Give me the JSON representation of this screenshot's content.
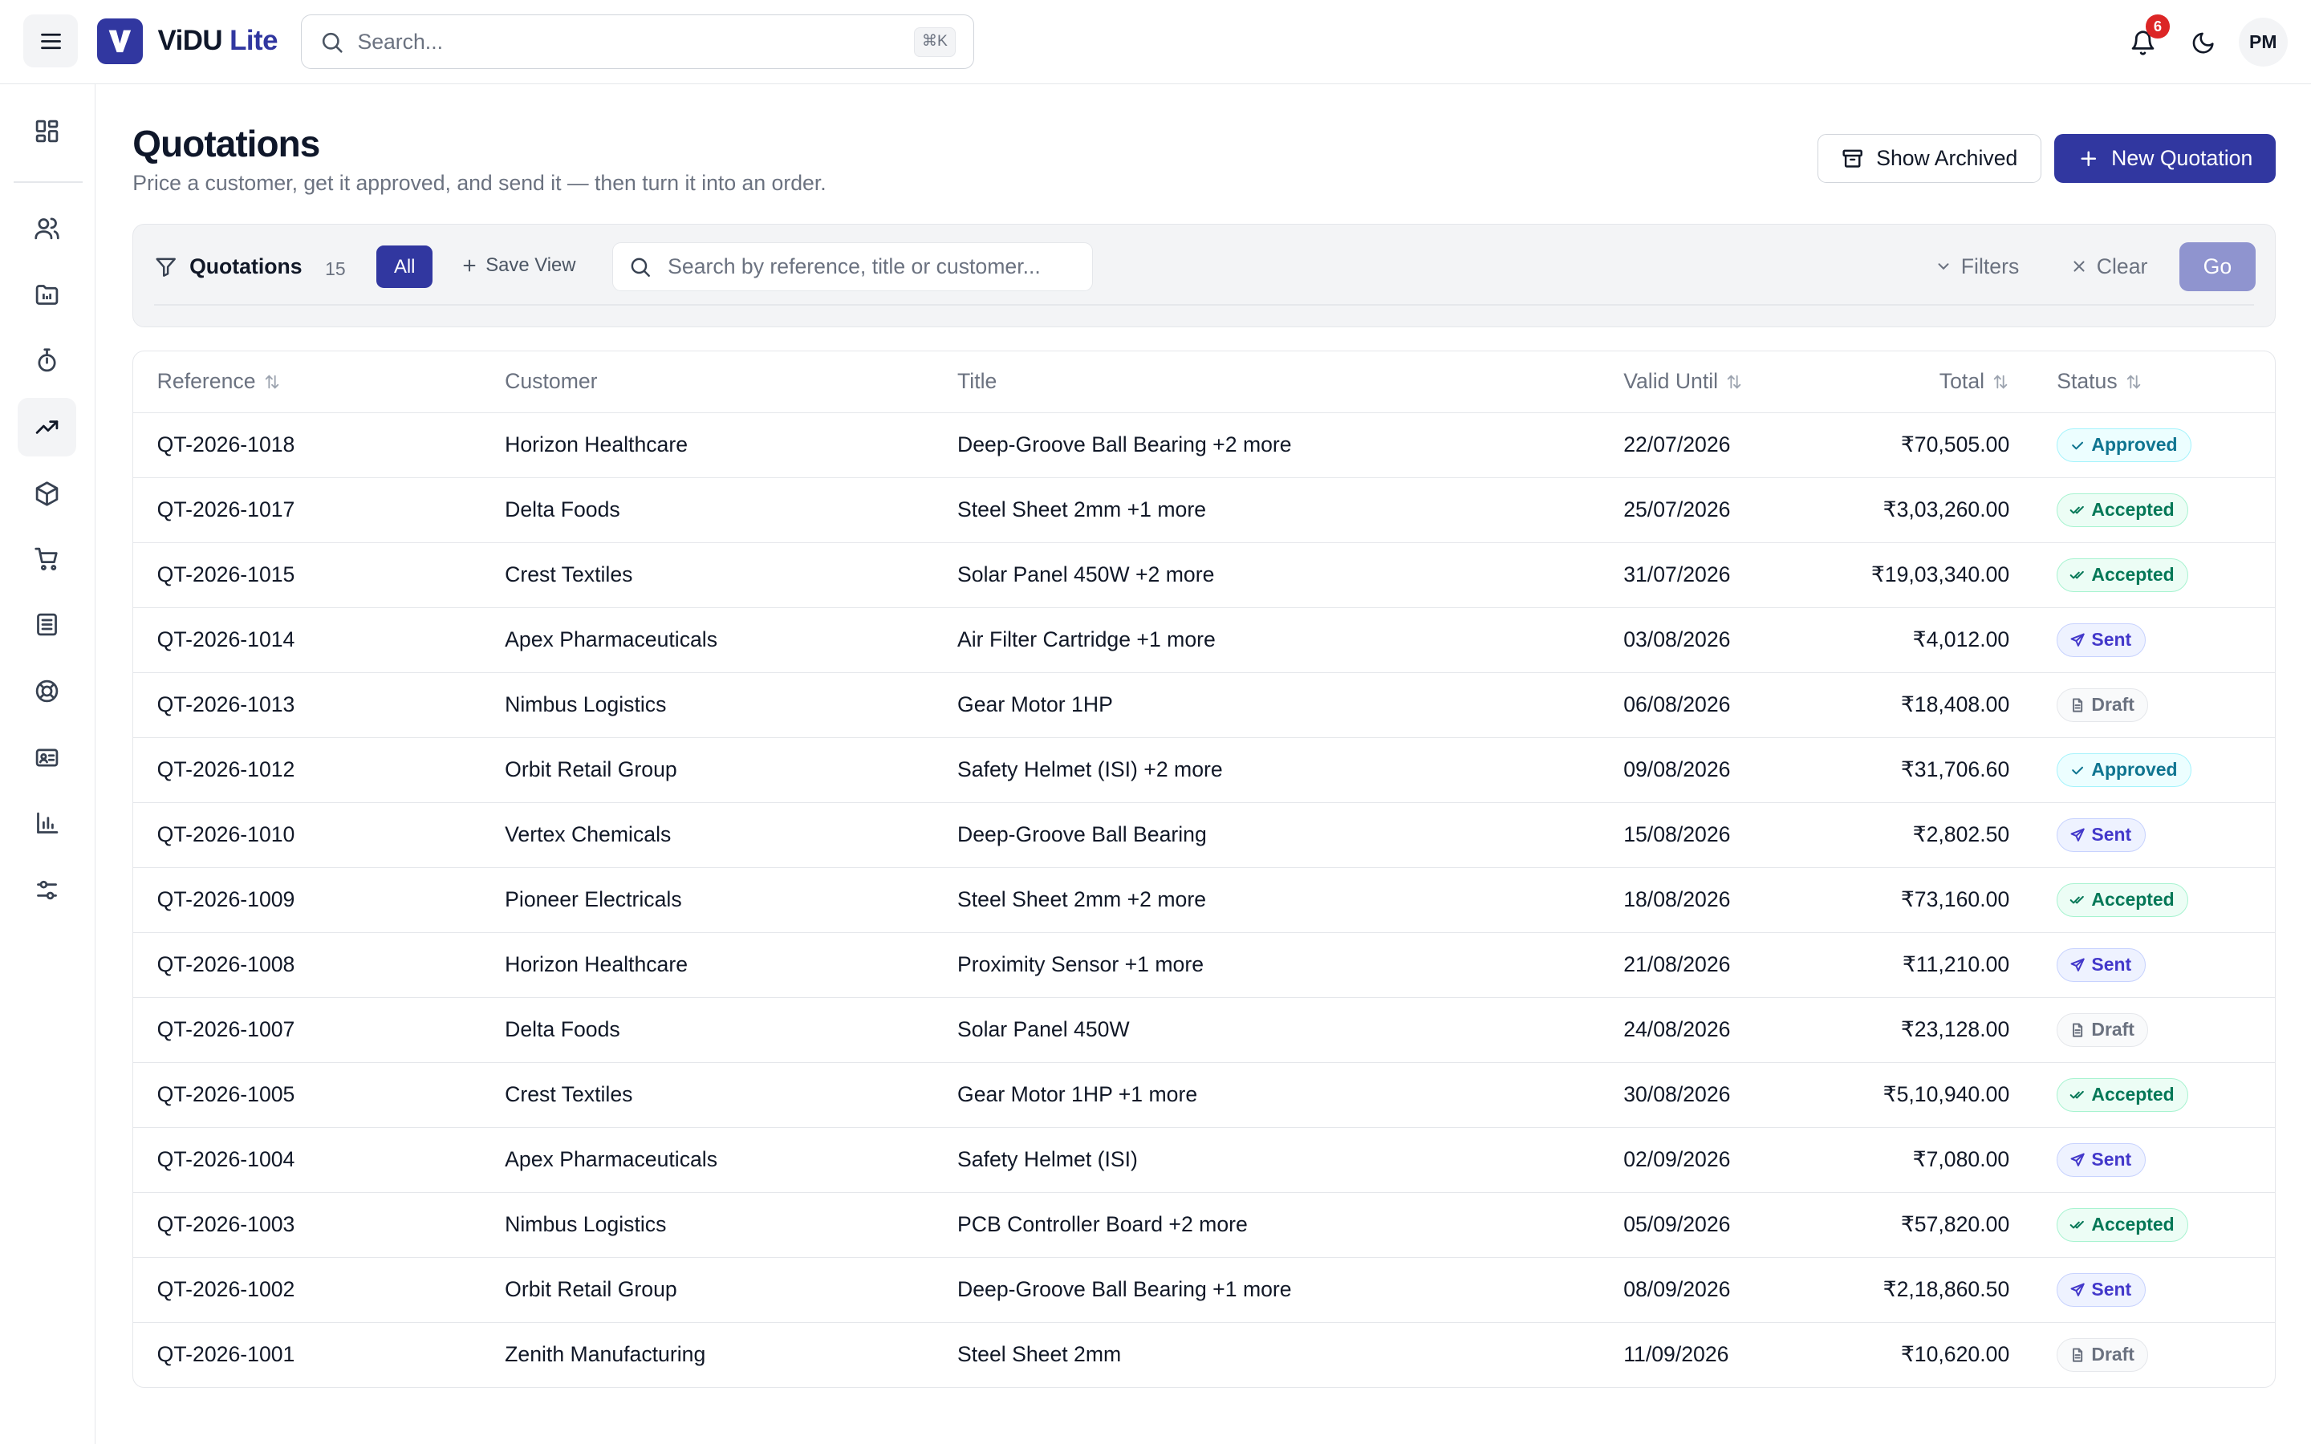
{
  "app": {
    "brand_main": "ViDU",
    "brand_sub": "Lite",
    "brand_color": "#3137a0"
  },
  "topbar": {
    "search_placeholder": "Search...",
    "search_shortcut": "⌘K",
    "notification_count": "6",
    "avatar_initials": "PM"
  },
  "sidebar": {
    "items": [
      {
        "icon": "dashboard-icon",
        "active": false
      },
      {
        "icon": "users-icon",
        "active": false
      },
      {
        "icon": "projects-folder-icon",
        "active": false
      },
      {
        "icon": "stopwatch-icon",
        "active": false
      },
      {
        "icon": "sales-trend-icon",
        "active": true
      },
      {
        "icon": "package-icon",
        "active": false
      },
      {
        "icon": "cart-icon",
        "active": false
      },
      {
        "icon": "ledger-icon",
        "active": false
      },
      {
        "icon": "support-lifebuoy-icon",
        "active": false
      },
      {
        "icon": "id-card-icon",
        "active": false
      },
      {
        "icon": "bar-chart-icon",
        "active": false
      },
      {
        "icon": "settings-sliders-icon",
        "active": false
      }
    ]
  },
  "page": {
    "title": "Quotations",
    "subtitle": "Price a customer, get it approved, and send it — then turn it into an order.",
    "show_archived_label": "Show Archived",
    "new_quotation_label": "New Quotation"
  },
  "filterbar": {
    "title": "Quotations",
    "count": "15",
    "active_view": "All",
    "save_view_label": "Save View",
    "search_placeholder": "Search by reference, title or customer...",
    "filters_label": "Filters",
    "clear_label": "Clear",
    "go_label": "Go"
  },
  "table": {
    "columns": {
      "reference": "Reference",
      "customer": "Customer",
      "title": "Title",
      "valid_until": "Valid Until",
      "total": "Total",
      "status": "Status"
    },
    "rows": [
      {
        "reference": "QT-2026-1018",
        "customer": "Horizon Healthcare",
        "title": "Deep-Groove Ball Bearing +2 more",
        "valid_until": "22/07/2026",
        "total": "₹70,505.00",
        "status": "Approved"
      },
      {
        "reference": "QT-2026-1017",
        "customer": "Delta Foods",
        "title": "Steel Sheet 2mm +1 more",
        "valid_until": "25/07/2026",
        "total": "₹3,03,260.00",
        "status": "Accepted"
      },
      {
        "reference": "QT-2026-1015",
        "customer": "Crest Textiles",
        "title": "Solar Panel 450W +2 more",
        "valid_until": "31/07/2026",
        "total": "₹19,03,340.00",
        "status": "Accepted"
      },
      {
        "reference": "QT-2026-1014",
        "customer": "Apex Pharmaceuticals",
        "title": "Air Filter Cartridge +1 more",
        "valid_until": "03/08/2026",
        "total": "₹4,012.00",
        "status": "Sent"
      },
      {
        "reference": "QT-2026-1013",
        "customer": "Nimbus Logistics",
        "title": "Gear Motor 1HP",
        "valid_until": "06/08/2026",
        "total": "₹18,408.00",
        "status": "Draft"
      },
      {
        "reference": "QT-2026-1012",
        "customer": "Orbit Retail Group",
        "title": "Safety Helmet (ISI) +2 more",
        "valid_until": "09/08/2026",
        "total": "₹31,706.60",
        "status": "Approved"
      },
      {
        "reference": "QT-2026-1010",
        "customer": "Vertex Chemicals",
        "title": "Deep-Groove Ball Bearing",
        "valid_until": "15/08/2026",
        "total": "₹2,802.50",
        "status": "Sent"
      },
      {
        "reference": "QT-2026-1009",
        "customer": "Pioneer Electricals",
        "title": "Steel Sheet 2mm +2 more",
        "valid_until": "18/08/2026",
        "total": "₹73,160.00",
        "status": "Accepted"
      },
      {
        "reference": "QT-2026-1008",
        "customer": "Horizon Healthcare",
        "title": "Proximity Sensor +1 more",
        "valid_until": "21/08/2026",
        "total": "₹11,210.00",
        "status": "Sent"
      },
      {
        "reference": "QT-2026-1007",
        "customer": "Delta Foods",
        "title": "Solar Panel 450W",
        "valid_until": "24/08/2026",
        "total": "₹23,128.00",
        "status": "Draft"
      },
      {
        "reference": "QT-2026-1005",
        "customer": "Crest Textiles",
        "title": "Gear Motor 1HP +1 more",
        "valid_until": "30/08/2026",
        "total": "₹5,10,940.00",
        "status": "Accepted"
      },
      {
        "reference": "QT-2026-1004",
        "customer": "Apex Pharmaceuticals",
        "title": "Safety Helmet (ISI)",
        "valid_until": "02/09/2026",
        "total": "₹7,080.00",
        "status": "Sent"
      },
      {
        "reference": "QT-2026-1003",
        "customer": "Nimbus Logistics",
        "title": "PCB Controller Board +2 more",
        "valid_until": "05/09/2026",
        "total": "₹57,820.00",
        "status": "Accepted"
      },
      {
        "reference": "QT-2026-1002",
        "customer": "Orbit Retail Group",
        "title": "Deep-Groove Ball Bearing +1 more",
        "valid_until": "08/09/2026",
        "total": "₹2,18,860.50",
        "status": "Sent"
      },
      {
        "reference": "QT-2026-1001",
        "customer": "Zenith Manufacturing",
        "title": "Steel Sheet 2mm",
        "valid_until": "11/09/2026",
        "total": "₹10,620.00",
        "status": "Draft"
      }
    ]
  },
  "status_styles": {
    "Approved": {
      "text": "#0e7490",
      "bg": "#ecfeff",
      "border": "#a5f3fc",
      "icon": "check-icon"
    },
    "Accepted": {
      "text": "#047857",
      "bg": "#ecfdf5",
      "border": "#a7f3d0",
      "icon": "double-check-icon"
    },
    "Sent": {
      "text": "#4338ca",
      "bg": "#eef2ff",
      "border": "#c7d2fe",
      "icon": "send-icon"
    },
    "Draft": {
      "text": "#6b7280",
      "bg": "#f9fafb",
      "border": "#e5e7eb",
      "icon": "document-icon"
    }
  }
}
